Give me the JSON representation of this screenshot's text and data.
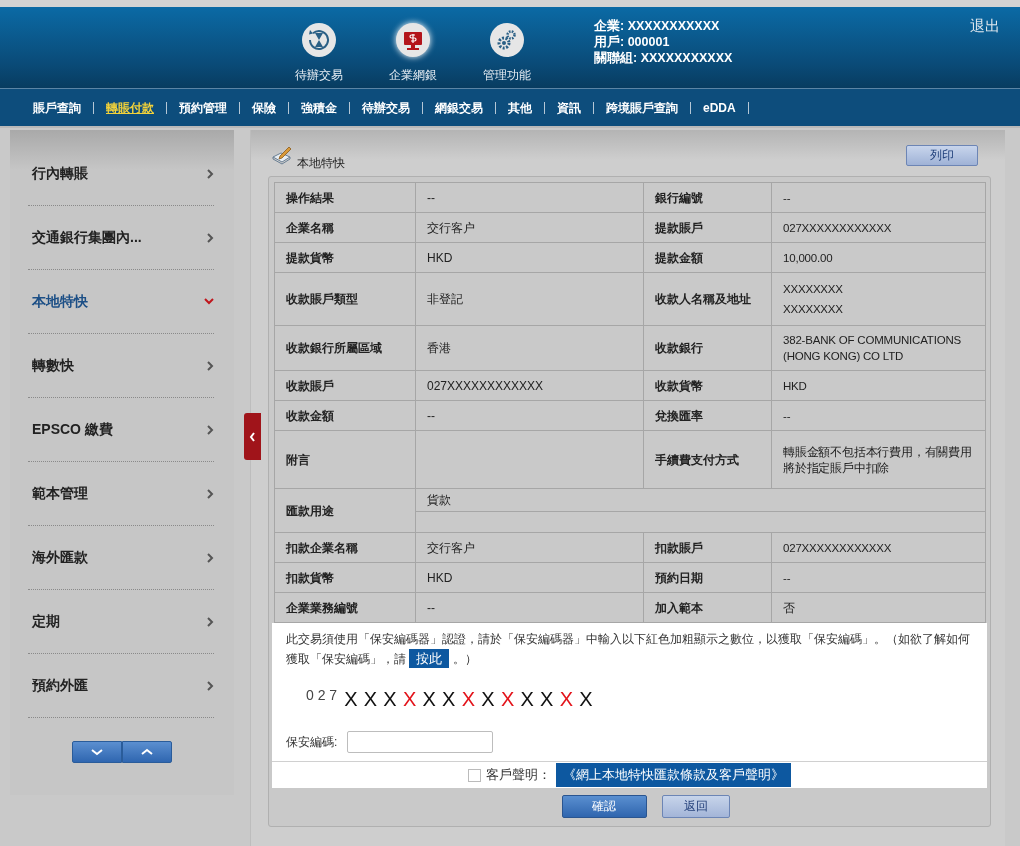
{
  "header": {
    "shortcuts": [
      {
        "kind": "hourglass",
        "label": "待辦交易",
        "selected": false
      },
      {
        "kind": "monitor",
        "label": "企業網銀",
        "selected": true
      },
      {
        "kind": "gears",
        "label": "管理功能",
        "selected": false
      }
    ],
    "user_info": [
      "企業: XXXXXXXXXXX",
      "用戶: 000001",
      "關聯組: XXXXXXXXXXX"
    ],
    "logout": "退出"
  },
  "nav": {
    "items": [
      {
        "label": "賬戶查詢",
        "selected": false
      },
      {
        "label": "轉賬付款",
        "selected": true
      },
      {
        "label": "預約管理",
        "selected": false
      },
      {
        "label": "保險",
        "selected": false
      },
      {
        "label": "強積金",
        "selected": false
      },
      {
        "label": "待辦交易",
        "selected": false
      },
      {
        "label": "網銀交易",
        "selected": false
      },
      {
        "label": "其他",
        "selected": false
      },
      {
        "label": "資訊",
        "selected": false
      },
      {
        "label": "跨境賬戶查詢",
        "selected": false
      },
      {
        "label": "eDDA",
        "selected": false
      }
    ]
  },
  "sidebar": {
    "items": [
      {
        "label": "行內轉賬",
        "selected": false
      },
      {
        "label": "交通銀行集團內...",
        "selected": false
      },
      {
        "label": "本地特快",
        "selected": true
      },
      {
        "label": "轉數快",
        "selected": false
      },
      {
        "label": "EPSCO 繳費",
        "selected": false
      },
      {
        "label": "範本管理",
        "selected": false
      },
      {
        "label": "海外匯款",
        "selected": false
      },
      {
        "label": "定期",
        "selected": false
      },
      {
        "label": "預約外匯",
        "selected": false
      }
    ]
  },
  "panel": {
    "title": "本地特快",
    "print_button": "列印",
    "table": {
      "rows": [
        {
          "kind": "pair",
          "cells": [
            "操作結果",
            "--",
            "銀行編號",
            "--"
          ]
        },
        {
          "kind": "pair",
          "cells": [
            "企業名稱",
            "交行客户",
            "提款賬戶",
            "027XXXXXXXXXXXX"
          ]
        },
        {
          "kind": "pair",
          "cells": [
            "提款貨幣",
            "HKD",
            "提款金額",
            "10,000.00"
          ]
        },
        {
          "kind": "pair",
          "cells": [
            "收款賬戶類型",
            "非登記",
            "收款人名稱及地址",
            "XXXXXXXX\nXXXXXXXX"
          ]
        },
        {
          "kind": "pair",
          "cells": [
            "收款銀行所屬區域",
            "香港",
            "收款銀行",
            "382-BANK OF COMMUNICATIONS (HONG KONG) CO LTD"
          ]
        },
        {
          "kind": "pair",
          "cells": [
            "收款賬戶",
            "027XXXXXXXXXXXX",
            "收款貨幣",
            "HKD"
          ]
        },
        {
          "kind": "pair",
          "cells": [
            "收款金額",
            "--",
            "兌換匯率",
            "--"
          ]
        },
        {
          "kind": "tall",
          "cells": [
            "附言",
            "",
            "手續費支付方式",
            "轉賬金額不包括本行費用，有關費用將於指定賬戶中扣除"
          ]
        },
        {
          "kind": "wide",
          "label": "匯款用途",
          "value": "貨款"
        },
        {
          "kind": "pair",
          "cells": [
            "扣款企業名稱",
            "交行客户",
            "扣款賬戶",
            "027XXXXXXXXXXXX"
          ]
        },
        {
          "kind": "pair",
          "cells": [
            "扣款貨幣",
            "HKD",
            "預約日期",
            "--"
          ]
        },
        {
          "kind": "pair",
          "cells": [
            "企業業務編號",
            "--",
            "加入範本",
            "否"
          ]
        }
      ]
    },
    "security": {
      "text_before": "此交易須使用「保安編碼器」認證，請於「保安編碼器」中輸入以下紅色加粗顯示之數位，以獲取「保安編碼」。（如欲了解如何獲取「保安編碼」，請 ",
      "link": "按此",
      "text_after": " 。）",
      "code_prefix": "0 2 7",
      "code": [
        {
          "char": "X",
          "highlighted": false
        },
        {
          "char": "X",
          "highlighted": false
        },
        {
          "char": "X",
          "highlighted": false
        },
        {
          "char": "X",
          "highlighted": true
        },
        {
          "char": "X",
          "highlighted": false
        },
        {
          "char": "X",
          "highlighted": false
        },
        {
          "char": "X",
          "highlighted": true
        },
        {
          "char": "X",
          "highlighted": false
        },
        {
          "char": "X",
          "highlighted": true
        },
        {
          "char": "X",
          "highlighted": false
        },
        {
          "char": "X",
          "highlighted": false
        },
        {
          "char": "X",
          "highlighted": true
        },
        {
          "char": "X",
          "highlighted": false
        }
      ],
      "field_label": "保安編碼:"
    },
    "declaration": {
      "checked": false,
      "label": "客戶聲明：",
      "link": "《網上本地特快匯款條款及客戶聲明》"
    },
    "buttons": [
      {
        "kind": "primary",
        "label": "確認"
      },
      {
        "kind": "secondary",
        "label": "返回"
      }
    ]
  }
}
